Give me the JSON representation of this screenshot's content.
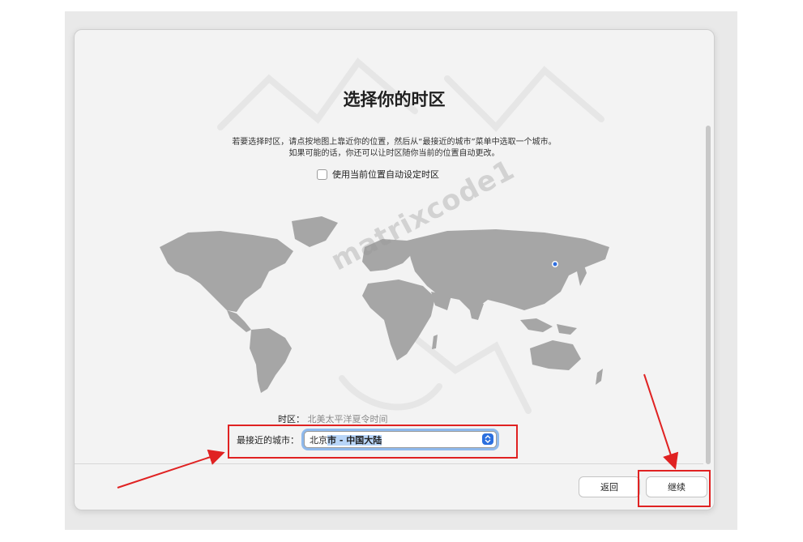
{
  "setup": {
    "title": "选择你的时区",
    "description_line1": "若要选择时区，请点按地图上靠近你的位置，然后从“最接近的城市”菜单中选取一个城市。",
    "description_line2": "如果可能的话，你还可以让时区随你当前的位置自动更改。",
    "auto_timezone_label": "使用当前位置自动设定时区",
    "auto_timezone_checked": false,
    "timezone_label": "时区：",
    "timezone_value": "北美太平洋夏令时间",
    "closest_city_label": "最接近的城市：",
    "closest_city_prefix": "北京",
    "closest_city_highlighted": "市 - 中国大陆",
    "watermark": "matrixcode1"
  },
  "buttons": {
    "back_label": "返回",
    "continue_label": "继续"
  },
  "colors": {
    "annotation_red": "#e02222",
    "selection_blue": "#b8d5f8",
    "focus_ring": "#8fb9ec",
    "dropdown_accent": "#2b6fde",
    "map_land": "#a6a6a6"
  },
  "icons": {
    "dropdown": "chevron-updown-icon",
    "location_pin": "location-dot-icon"
  }
}
